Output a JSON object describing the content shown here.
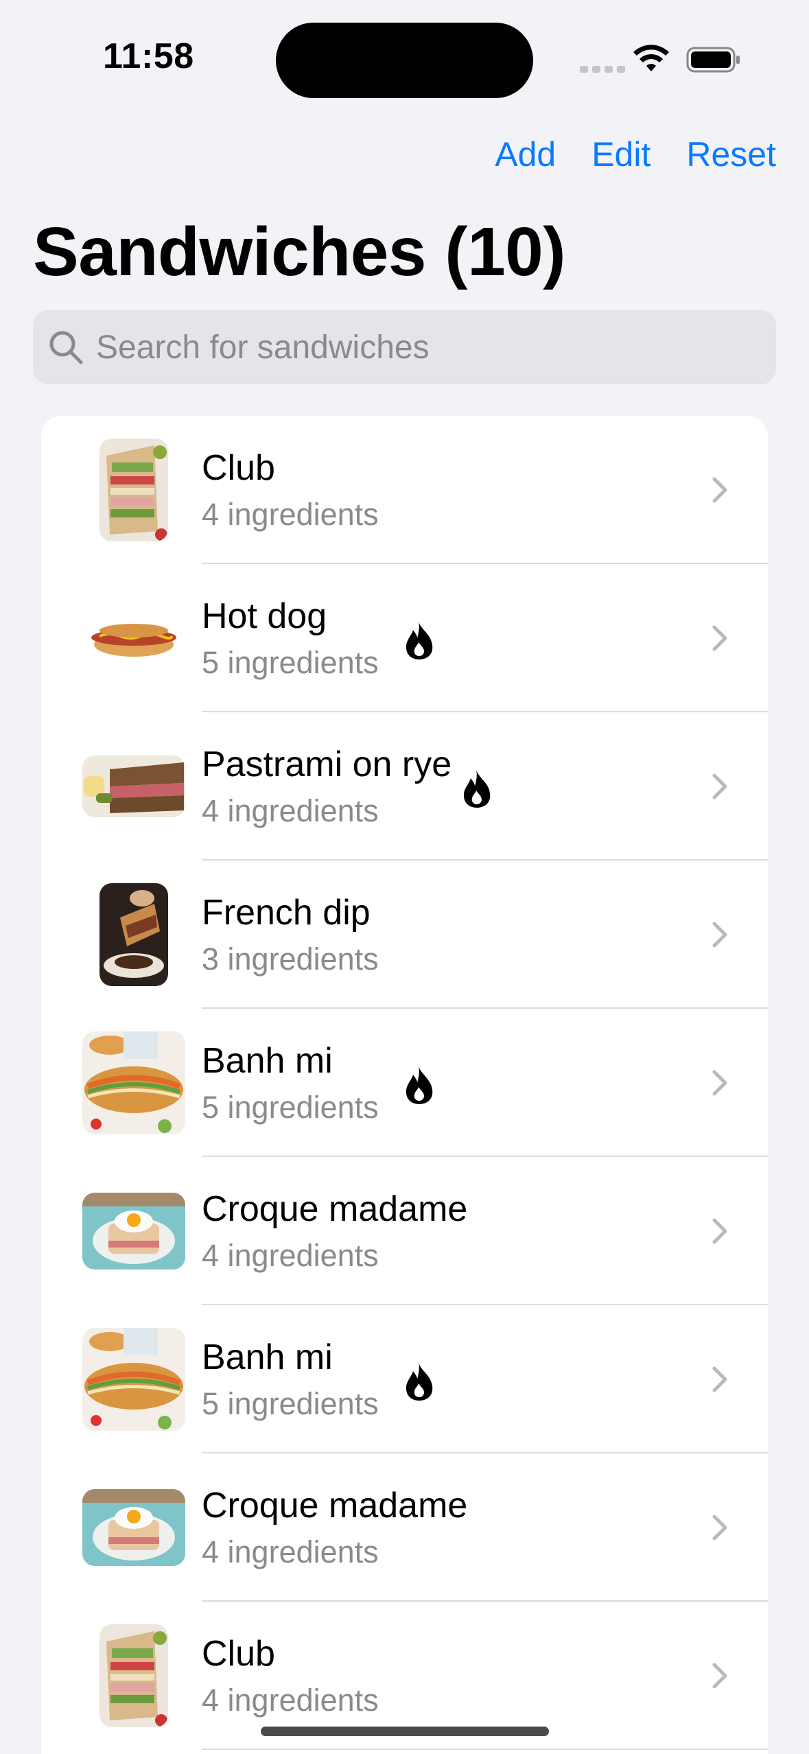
{
  "status": {
    "time": "11:58"
  },
  "nav": {
    "add": "Add",
    "edit": "Edit",
    "reset": "Reset"
  },
  "title": "Sandwiches (10)",
  "search": {
    "placeholder": "Search for sandwiches"
  },
  "rows": [
    {
      "name": "Club",
      "ingredients": "4 ingredients",
      "spicy": false,
      "image": "club-sandwich"
    },
    {
      "name": "Hot dog",
      "ingredients": "5 ingredients",
      "spicy": true,
      "image": "hot-dog"
    },
    {
      "name": "Pastrami on rye",
      "ingredients": "4 ingredients",
      "spicy": true,
      "image": "pastrami-sandwich"
    },
    {
      "name": "French dip",
      "ingredients": "3 ingredients",
      "spicy": false,
      "image": "french-dip"
    },
    {
      "name": "Banh mi",
      "ingredients": "5 ingredients",
      "spicy": true,
      "image": "banh-mi"
    },
    {
      "name": "Croque madame",
      "ingredients": "4 ingredients",
      "spicy": false,
      "image": "croque-madame"
    },
    {
      "name": "Banh mi",
      "ingredients": "5 ingredients",
      "spicy": true,
      "image": "banh-mi"
    },
    {
      "name": "Croque madame",
      "ingredients": "4 ingredients",
      "spicy": false,
      "image": "croque-madame"
    },
    {
      "name": "Club",
      "ingredients": "4 ingredients",
      "spicy": false,
      "image": "club-sandwich"
    }
  ],
  "colors": {
    "accent": "#0a7aff",
    "background": "#f2f2f7",
    "secondary_text": "#8a8a8e"
  }
}
